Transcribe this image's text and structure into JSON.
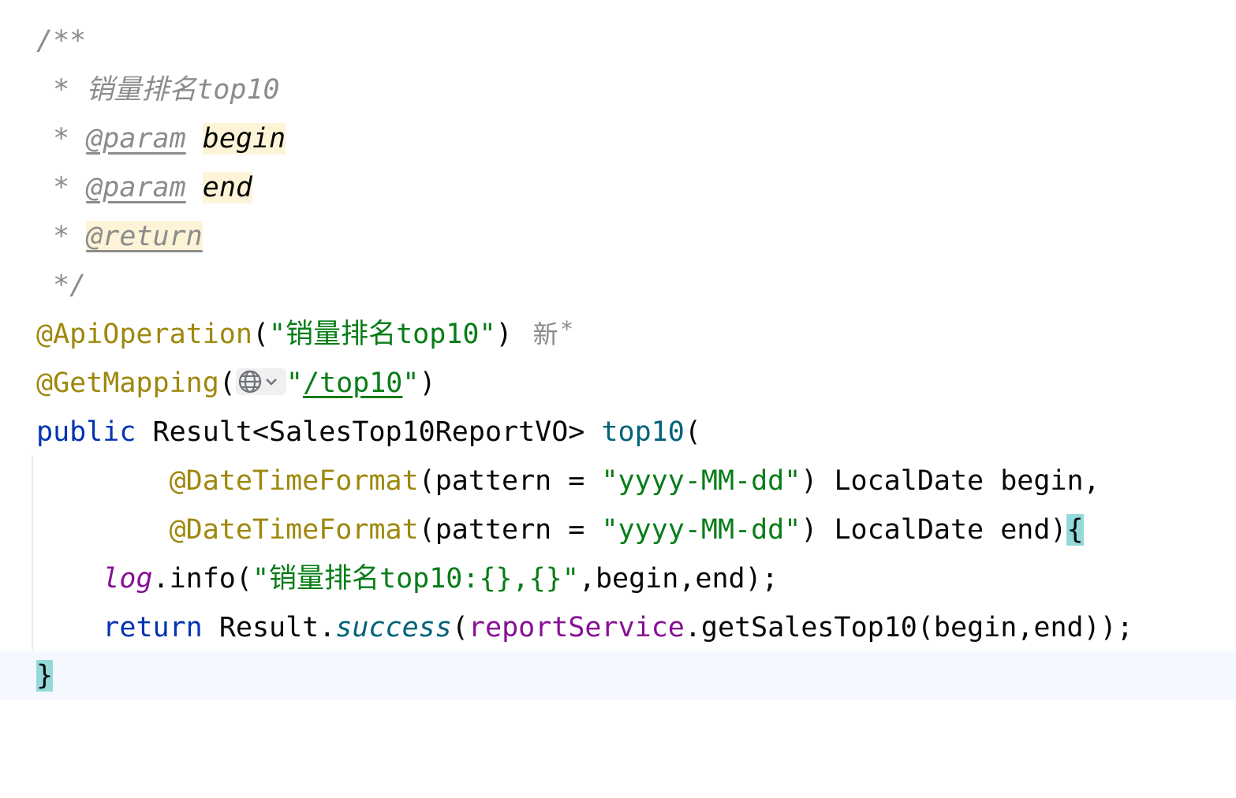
{
  "javadoc": {
    "open": "/**",
    "star": "*",
    "description": "销量排名top10",
    "param_tag": "@param",
    "param1": "begin",
    "param2": "end",
    "return_tag": "@return",
    "close": "*/"
  },
  "annotations": {
    "api_operation": "@ApiOperation",
    "api_operation_value": "\"销量排名top10\"",
    "get_mapping": "@GetMapping",
    "get_mapping_path": "/top10",
    "inlay_author": "新",
    "inlay_star": "*"
  },
  "signature": {
    "modifier": "public",
    "return_type": "Result<SalesTop10ReportVO>",
    "method_name": "top10",
    "param_annotation": "@DateTimeFormat",
    "pattern_text": "(pattern = ",
    "pattern_value": "\"yyyy-MM-dd\"",
    "param1_decl": ") LocalDate begin,",
    "param2_decl": ") LocalDate end)",
    "open_brace": "{"
  },
  "body": {
    "log_field": "log",
    "log_call": ".info(",
    "log_message": "\"销量排名top10:{},{}\"",
    "log_args": ",begin,end);",
    "return_kw": "return",
    "result_class": "Result.",
    "success_method": "success",
    "report_service": "reportService",
    "service_call": ".getSalesTop10(begin,end));",
    "close_brace": "}"
  },
  "icons": {
    "endpoint": "globe-icon",
    "dropdown": "chevron-down-icon"
  },
  "colors": {
    "comment": "#8c8c8c",
    "annotation": "#9e880d",
    "string": "#067d17",
    "keyword": "#0033b3",
    "method": "#00627a",
    "field": "#871094",
    "brace_match": "#93d9d9",
    "param_highlight": "#fdf4d8"
  }
}
